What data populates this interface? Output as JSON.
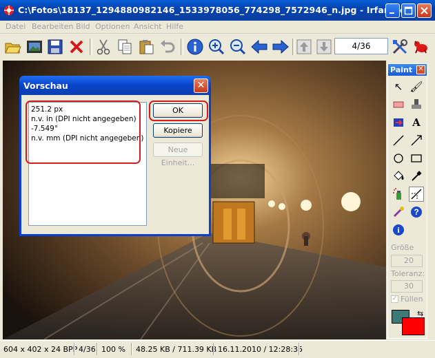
{
  "window": {
    "title": "C:\\Fotos\\18137_1294880982146_1533978056_774298_7572946_n.jpg - IrfanView"
  },
  "menu": [
    "Datei",
    "Bearbeiten",
    "Bild",
    "Optionen",
    "Ansicht",
    "Hilfe"
  ],
  "toolbar": {
    "page_counter": "4/36",
    "icons": [
      "open-icon",
      "slideshow-icon",
      "save-icon",
      "delete-icon",
      "cut-icon",
      "copy-icon",
      "paste-icon",
      "undo-icon",
      "info-icon",
      "zoom-in-icon",
      "zoom-out-icon",
      "previous-icon",
      "next-icon",
      "first-page-icon",
      "last-page-icon",
      "options-icon",
      "irfanview-logo-icon"
    ]
  },
  "dialog": {
    "title": "Vorschau",
    "lines": [
      "251.2 px",
      "n.v. in (DPI nicht angegeben)",
      "-7.549°",
      "n.v. mm (DPI nicht angegeben)"
    ],
    "ok_label": "OK",
    "copy_label": "Kopiere",
    "new_unit_label": "Neue Einheit..."
  },
  "paint": {
    "title": "Paint",
    "size_label": "Größe",
    "size_value": "20",
    "tolerance_label": "Toleranz:",
    "tolerance_value": "30",
    "fill_label": "Füllen",
    "fill_checked": true,
    "foreground_color": "#3c7a78",
    "background_color": "#ff0000",
    "tools": [
      "cursor",
      "brush",
      "eraser",
      "stamp",
      "color-replace",
      "text",
      "line",
      "arrow",
      "ellipse",
      "rectangle",
      "fill",
      "color-picker",
      "spray",
      "line-measure",
      "effects",
      "help",
      "info"
    ]
  },
  "status": {
    "dimensions": "604 x 402 x 24 BPP",
    "index": "4/36",
    "zoom": "100 %",
    "filesize": "48.25 KB / 711.39 KB",
    "datetime": "16.11.2010 / 12:28:35"
  }
}
